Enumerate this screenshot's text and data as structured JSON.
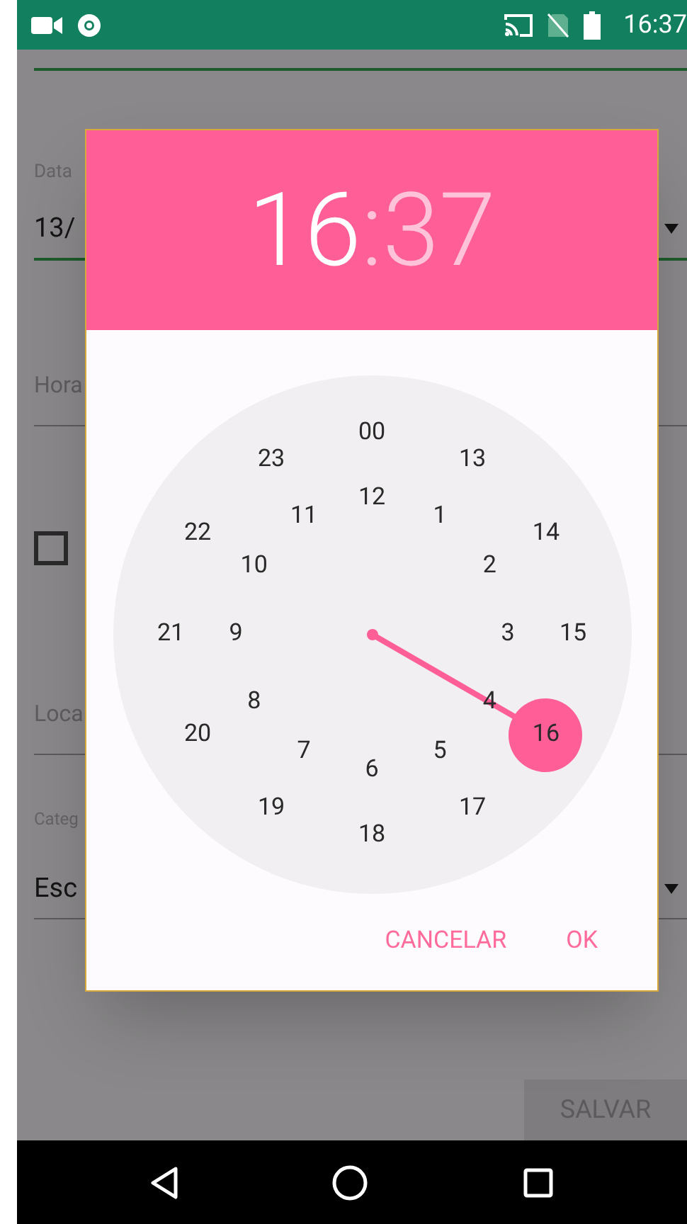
{
  "status_bar": {
    "time": "16:37"
  },
  "form": [
    {
      "kind": "dropdown",
      "label": "Data",
      "value": "13/"
    },
    {
      "kind": "text",
      "placeholder": "Hora"
    },
    {
      "kind": "checkbox",
      "checked": false
    },
    {
      "kind": "text",
      "placeholder": "Loca"
    },
    {
      "kind": "dropdown",
      "label": "Categ",
      "value": "Esc"
    }
  ],
  "save_button": {
    "label": "SALVAR",
    "disabled": true
  },
  "dialog": {
    "hour": "16",
    "separator": ":",
    "minute": "37",
    "hour_selected": true,
    "outer": [
      {
        "label": "00",
        "selected": false
      },
      {
        "label": "13",
        "selected": false
      },
      {
        "label": "14",
        "selected": false
      },
      {
        "label": "15",
        "selected": false
      },
      {
        "label": "16",
        "selected": true
      },
      {
        "label": "17",
        "selected": false
      },
      {
        "label": "18",
        "selected": false
      },
      {
        "label": "19",
        "selected": false
      },
      {
        "label": "20",
        "selected": false
      },
      {
        "label": "21",
        "selected": false
      },
      {
        "label": "22",
        "selected": false
      },
      {
        "label": "23",
        "selected": false
      }
    ],
    "inner": [
      {
        "label": "12",
        "selected": false
      },
      {
        "label": "1",
        "selected": false
      },
      {
        "label": "2",
        "selected": false
      },
      {
        "label": "3",
        "selected": false
      },
      {
        "label": "4",
        "selected": false
      },
      {
        "label": "5",
        "selected": false
      },
      {
        "label": "6",
        "selected": false
      },
      {
        "label": "7",
        "selected": false
      },
      {
        "label": "8",
        "selected": false
      },
      {
        "label": "9",
        "selected": false
      },
      {
        "label": "10",
        "selected": false
      },
      {
        "label": "11",
        "selected": false
      }
    ],
    "buttons": [
      "CANCELAR",
      "OK"
    ]
  }
}
